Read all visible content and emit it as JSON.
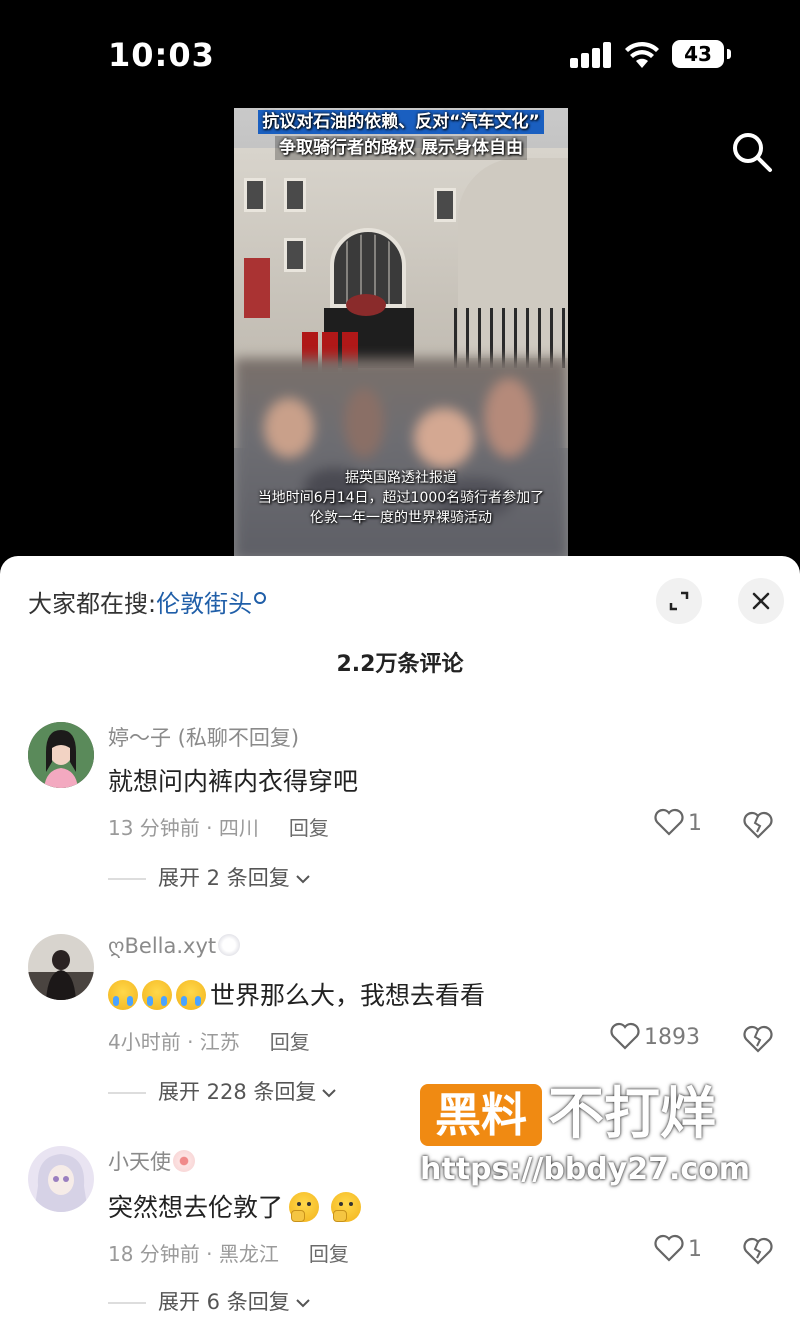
{
  "status_bar": {
    "time": "10:03",
    "battery": "43"
  },
  "video": {
    "title_line1": "抗议对石油的依赖、反对“汽车文化”",
    "title_line2": "争取骑行者的路权 展示身体自由",
    "caption_line1": "据英国路透社报道",
    "caption_line2": "当地时间6月14日，超过1000名骑行者参加了",
    "caption_line3": "伦敦一年一度的世界裸骑活动"
  },
  "sheet": {
    "hot_search_prefix": "大家都在搜:",
    "hot_search_term": "伦敦街头",
    "comment_count": "2.2万条评论"
  },
  "comments": [
    {
      "username": "婷～子 (私聊不回复)",
      "text": "就想问内裤内衣得穿吧",
      "time_location": "13 分钟前 · 四川",
      "reply_label": "回复",
      "likes": "1",
      "more_replies": "展开 2 条回复"
    },
    {
      "username": "ღBella.xyt",
      "text": "世界那么大，我想去看看",
      "time_location": "4小时前 · 江苏",
      "reply_label": "回复",
      "likes": "1893",
      "more_replies": "展开 228 条回复"
    },
    {
      "username": "小天使",
      "text": "突然想去伦敦了",
      "time_location": "18 分钟前 · 黑龙江",
      "reply_label": "回复",
      "likes": "1",
      "more_replies": "展开 6 条回复"
    }
  ],
  "watermark": {
    "box_text": "黑料",
    "text": "不打烊",
    "url": "https://bbdy27.com"
  },
  "colors": {
    "accent_link": "#1f5ea8",
    "watermark_orange": "#f08a12"
  }
}
